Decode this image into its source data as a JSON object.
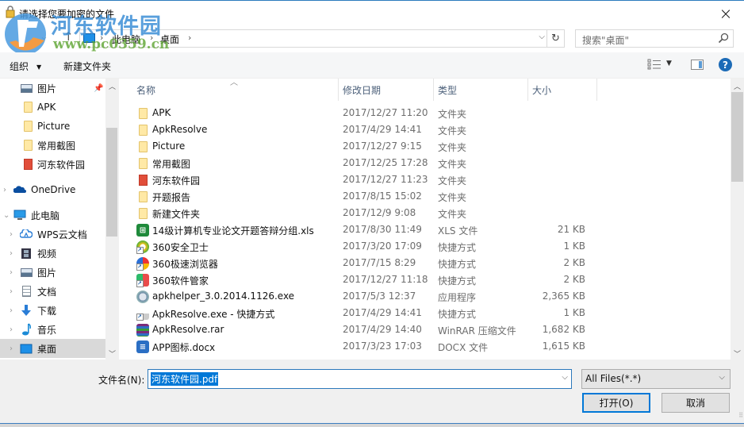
{
  "window": {
    "title": "请选择您要加密的文件",
    "close_label": "×"
  },
  "watermark": {
    "title": "河东软件园",
    "url": "www.pc0359.cn"
  },
  "address_bar": {
    "breadcrumbs": [
      "此电脑",
      "桌面"
    ],
    "search_placeholder": "搜索\"桌面\""
  },
  "toolbar": {
    "organize_label": "组织",
    "new_folder_label": "新建文件夹",
    "help_label": "?"
  },
  "nav_pane": {
    "items": [
      {
        "label": "图片",
        "icon": "picture-icon",
        "pinned": true
      },
      {
        "label": "APK",
        "icon": "folder-icon"
      },
      {
        "label": "Picture",
        "icon": "folder-icon"
      },
      {
        "label": "常用截图",
        "icon": "folder-icon"
      },
      {
        "label": "河东软件园",
        "icon": "red-folder-icon"
      },
      {
        "label": "OneDrive",
        "icon": "onedrive-icon"
      },
      {
        "label": "此电脑",
        "icon": "computer-icon"
      },
      {
        "label": "WPS云文档",
        "icon": "wps-cloud-icon"
      },
      {
        "label": "视频",
        "icon": "video-icon"
      },
      {
        "label": "图片",
        "icon": "picture-icon"
      },
      {
        "label": "文档",
        "icon": "document-icon"
      },
      {
        "label": "下载",
        "icon": "download-icon"
      },
      {
        "label": "音乐",
        "icon": "music-icon"
      },
      {
        "label": "桌面",
        "icon": "desktop-icon",
        "selected": true
      }
    ]
  },
  "file_list": {
    "columns": {
      "name": "名称",
      "date": "修改日期",
      "type": "类型",
      "size": "大小"
    },
    "rows": [
      {
        "name": "APK",
        "date": "2017/12/27 11:20",
        "type": "文件夹",
        "size": "",
        "icon": "folder-icon"
      },
      {
        "name": "ApkResolve",
        "date": "2017/4/29 14:41",
        "type": "文件夹",
        "size": "",
        "icon": "folder-icon"
      },
      {
        "name": "Picture",
        "date": "2017/12/27 9:15",
        "type": "文件夹",
        "size": "",
        "icon": "folder-icon"
      },
      {
        "name": "常用截图",
        "date": "2017/12/25 17:28",
        "type": "文件夹",
        "size": "",
        "icon": "folder-icon"
      },
      {
        "name": "河东软件园",
        "date": "2017/12/27 11:23",
        "type": "文件夹",
        "size": "",
        "icon": "red-folder-icon"
      },
      {
        "name": "开题报告",
        "date": "2017/8/15 15:02",
        "type": "文件夹",
        "size": "",
        "icon": "folder-icon"
      },
      {
        "name": "新建文件夹",
        "date": "2017/12/9 9:08",
        "type": "文件夹",
        "size": "",
        "icon": "folder-icon"
      },
      {
        "name": "14级计算机专业论文开题答辩分组.xls",
        "date": "2017/8/30 11:49",
        "type": "XLS 文件",
        "size": "21 KB",
        "icon": "xls-icon"
      },
      {
        "name": "360安全卫士",
        "date": "2017/3/20 17:09",
        "type": "快捷方式",
        "size": "1 KB",
        "icon": "360-safe-icon"
      },
      {
        "name": "360极速浏览器",
        "date": "2017/7/15 8:29",
        "type": "快捷方式",
        "size": "2 KB",
        "icon": "360-browser-icon"
      },
      {
        "name": "360软件管家",
        "date": "2017/12/27 11:18",
        "type": "快捷方式",
        "size": "2 KB",
        "icon": "360-software-icon"
      },
      {
        "name": "apkhelper_3.0.2014.1126.exe",
        "date": "2017/5/3 12:37",
        "type": "应用程序",
        "size": "2,365 KB",
        "icon": "exe-icon"
      },
      {
        "name": "ApkResolve.exe - 快捷方式",
        "date": "2017/4/29 14:41",
        "type": "快捷方式",
        "size": "1 KB",
        "icon": "apkresolve-shortcut-icon"
      },
      {
        "name": "ApkResolve.rar",
        "date": "2017/4/29 14:40",
        "type": "WinRAR 压缩文件",
        "size": "1,682 KB",
        "icon": "rar-icon"
      },
      {
        "name": "APP图标.docx",
        "date": "2017/3/23 17:03",
        "type": "DOCX 文件",
        "size": "1,615 KB",
        "icon": "docx-icon"
      }
    ]
  },
  "bottom": {
    "filename_label": "文件名(N):",
    "filename_value": "河东软件园.pdf",
    "filter_value": "All Files(*.*)",
    "open_label": "打开(O)",
    "cancel_label": "取消"
  }
}
